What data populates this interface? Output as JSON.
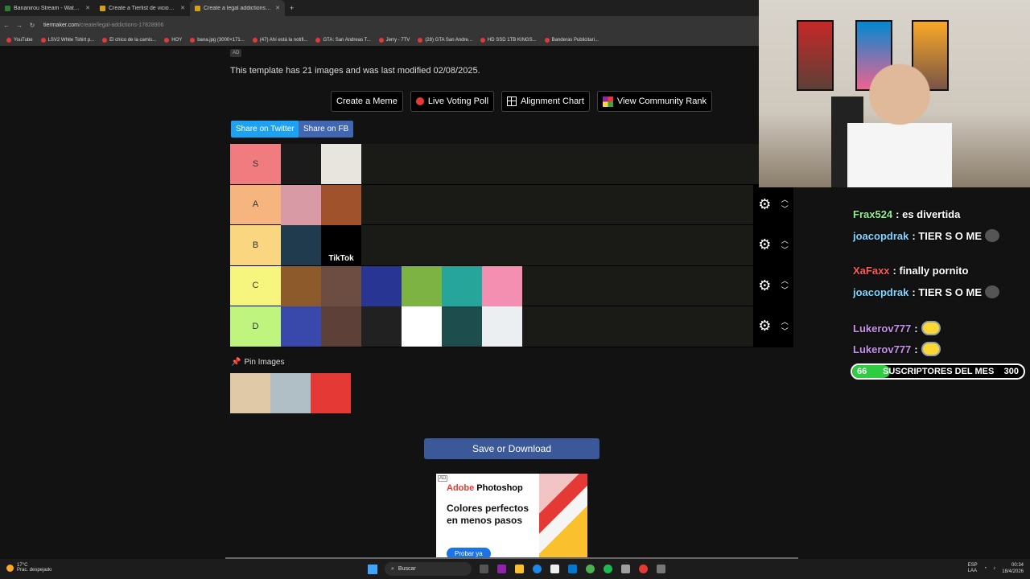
{
  "browser": {
    "tabs": [
      {
        "title": "Bananirou Stream - Watch Live",
        "active": false
      },
      {
        "title": "Create a Tierlist de vicios y adicciones",
        "active": false
      },
      {
        "title": "Create a legal addictions Tier List",
        "active": true
      }
    ],
    "url_domain": "tiermaker.com",
    "url_path": "/create/legal-addictions-17828906",
    "bookmarks": [
      "YouTube",
      "LSV2 White Tshirt p...",
      "El chico de la camis...",
      "HOY",
      "bana.jpg (3000×171...",
      "(47) Ahí está la notifi...",
      "GTA: San Andreas T...",
      "Jerry - 7TV",
      "(28) GTA San Andre...",
      "HD SSD 1TB KINGS...",
      "Banderas Publicitari..."
    ]
  },
  "page": {
    "ad_tag": "AD",
    "info_text": "This template has 21 images and was last modified 02/08/2025.",
    "buttons": {
      "create_meme": "Create a Meme",
      "live_poll": "Live Voting Poll",
      "alignment": "Alignment Chart",
      "community": "View Community Rank"
    },
    "share_twitter": "Share on Twitter",
    "share_fb": "Share on FB",
    "pin_label": "Pin Images",
    "save_label": "Save or Download"
  },
  "tiers": [
    {
      "label": "S",
      "color": "#f17c80",
      "items": [
        {
          "name": "monster-energy",
          "bg": "#1b1b1b",
          "text": ""
        },
        {
          "name": "coffee-cup",
          "bg": "#e8e4de",
          "text": ""
        }
      ]
    },
    {
      "label": "A",
      "color": "#f6b47f",
      "items": [
        {
          "name": "sugar",
          "bg": "#d89aa4",
          "text": ""
        },
        {
          "name": "fast-food",
          "bg": "#a0522d",
          "text": ""
        }
      ]
    },
    {
      "label": "B",
      "color": "#f9d67f",
      "items": [
        {
          "name": "smartphone",
          "bg": "#1f3b4d",
          "text": ""
        },
        {
          "name": "tiktok",
          "bg": "#000000",
          "text": "TikTok"
        }
      ]
    },
    {
      "label": "C",
      "color": "#f6f67e",
      "items": [
        {
          "name": "alcohol",
          "bg": "#8d5a2b",
          "text": ""
        },
        {
          "name": "gambling-table",
          "bg": "#6d4c41",
          "text": ""
        },
        {
          "name": "slot-machines",
          "bg": "#283593",
          "text": ""
        },
        {
          "name": "sports-betting",
          "bg": "#7cb342",
          "text": ""
        },
        {
          "name": "cannabis",
          "bg": "#26a69a",
          "text": ""
        },
        {
          "name": "mouth-pill",
          "bg": "#f48fb1",
          "text": ""
        }
      ]
    },
    {
      "label": "D",
      "color": "#bff47e",
      "items": [
        {
          "name": "horse-racing",
          "bg": "#3949ab",
          "text": ""
        },
        {
          "name": "pills-spoon",
          "bg": "#5d4037",
          "text": ""
        },
        {
          "name": "powder-lines",
          "bg": "#212121",
          "text": ""
        },
        {
          "name": "cigarette",
          "bg": "#ffffff",
          "text": ""
        },
        {
          "name": "vape",
          "bg": "#1e4d4d",
          "text": ""
        },
        {
          "name": "heated-tobacco",
          "bg": "#eceff1",
          "text": ""
        }
      ]
    }
  ],
  "pinned": [
    {
      "name": "pills",
      "bg": "#e0c9a6"
    },
    {
      "name": "xxx-box",
      "bg": "#b0bec5"
    },
    {
      "name": "zyn-tins",
      "bg": "#e53935"
    }
  ],
  "ad": {
    "tag": "AD",
    "brand_prefix": "Adobe",
    "brand": "Photoshop",
    "headline": "Colores perfectos en menos pasos",
    "cta": "Probar ya"
  },
  "chat": [
    {
      "user": "Frax524",
      "text": ": es divertida",
      "color": "u1",
      "badge": false,
      "emote": ""
    },
    {
      "user": "joacopdrak",
      "text": ": TIER S O ME",
      "color": "u2",
      "badge": false,
      "emote": "owl"
    },
    {
      "user": "XaFaxx",
      "text": ": finally pornito",
      "color": "u3",
      "badge": false,
      "emote": ""
    },
    {
      "user": "joacopdrak",
      "text": ": TIER S O ME",
      "color": "u2",
      "badge": false,
      "emote": "owl"
    },
    {
      "user": "Lukerov777",
      "text": ":",
      "color": "u4",
      "badge": false,
      "emote": "minion"
    },
    {
      "user": "Lukerov777",
      "text": ":",
      "color": "u4",
      "badge": false,
      "emote": "minion"
    }
  ],
  "subs_bar": {
    "count": "66",
    "label": "SUSCRIPTORES DEL MES",
    "goal": "300",
    "progress": 0.22
  },
  "taskbar": {
    "temp": "17°C",
    "weather": "Prac. despejado",
    "search": "Buscar",
    "lang1": "ESP",
    "lang2": "LAA",
    "time": "00:34",
    "date": "18/4/2026"
  }
}
